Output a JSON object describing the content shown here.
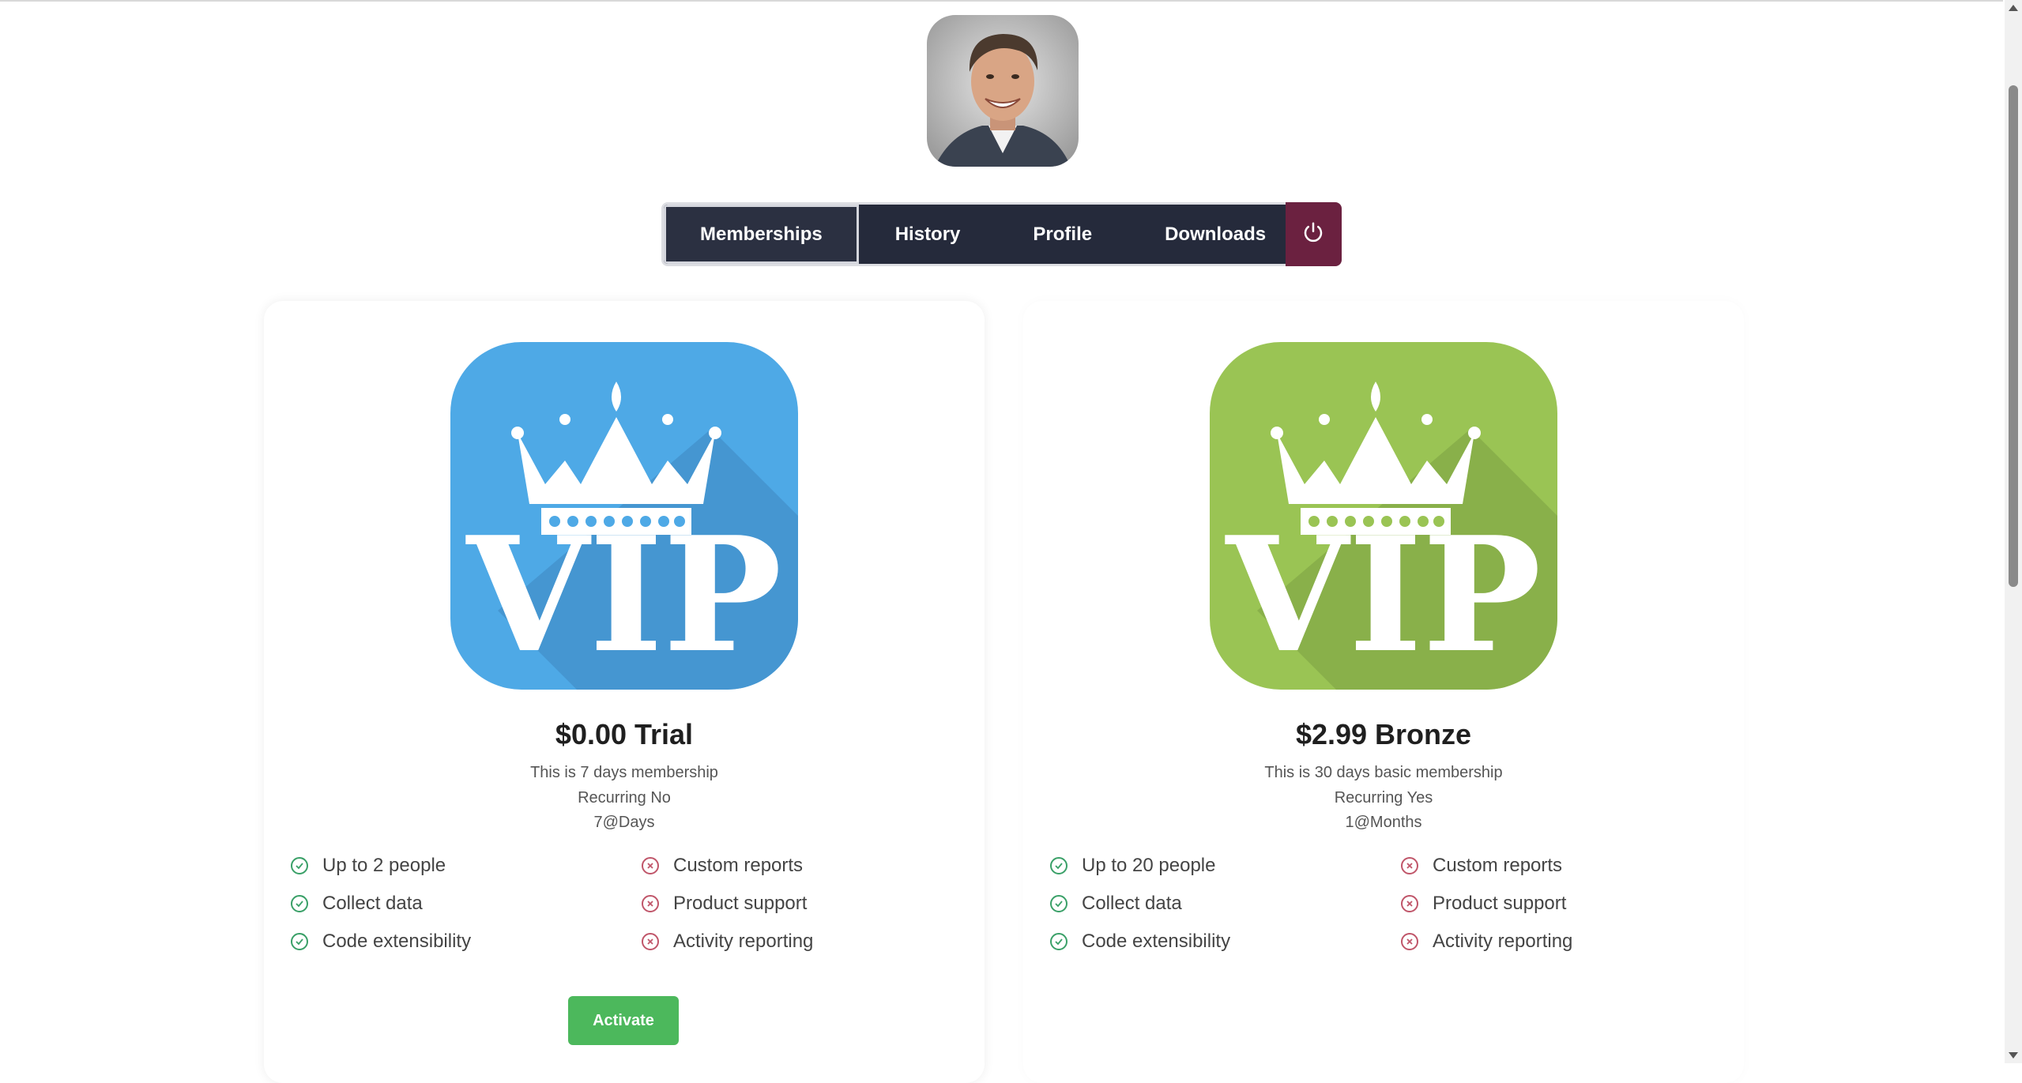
{
  "user": {
    "avatar_alt": "User avatar"
  },
  "nav": {
    "tabs": [
      {
        "label": "Memberships",
        "active": true
      },
      {
        "label": "History",
        "active": false
      },
      {
        "label": "Profile",
        "active": false
      },
      {
        "label": "Downloads",
        "active": false
      }
    ],
    "logout_icon": "power-icon"
  },
  "plans": [
    {
      "logo_text": "VIP",
      "logo_color": "#4ea9e6",
      "logo_shadow_color": "#4596d1",
      "title": "$0.00 Trial",
      "description": "This is 7 days membership",
      "recurring": "Recurring No",
      "period": "7@Days",
      "features_included": [
        "Up to 2 people",
        "Collect data",
        "Code extensibility"
      ],
      "features_excluded": [
        "Custom reports",
        "Product support",
        "Activity reporting"
      ],
      "action_label": "Activate"
    },
    {
      "logo_text": "VIP",
      "logo_color": "#9ac454",
      "logo_shadow_color": "#89b04a",
      "title": "$2.99 Bronze",
      "description": "This is 30 days basic membership",
      "recurring": "Recurring Yes",
      "period": "1@Months",
      "features_included": [
        "Up to 20 people",
        "Collect data",
        "Code extensibility"
      ],
      "features_excluded": [
        "Custom reports",
        "Product support",
        "Activity reporting"
      ]
    }
  ],
  "colors": {
    "nav_bg": "#252a3b",
    "logout_bg": "#6b2140",
    "activate_bg": "#4cb85c",
    "check_color": "#3aa068",
    "cross_color": "#c0566a"
  }
}
